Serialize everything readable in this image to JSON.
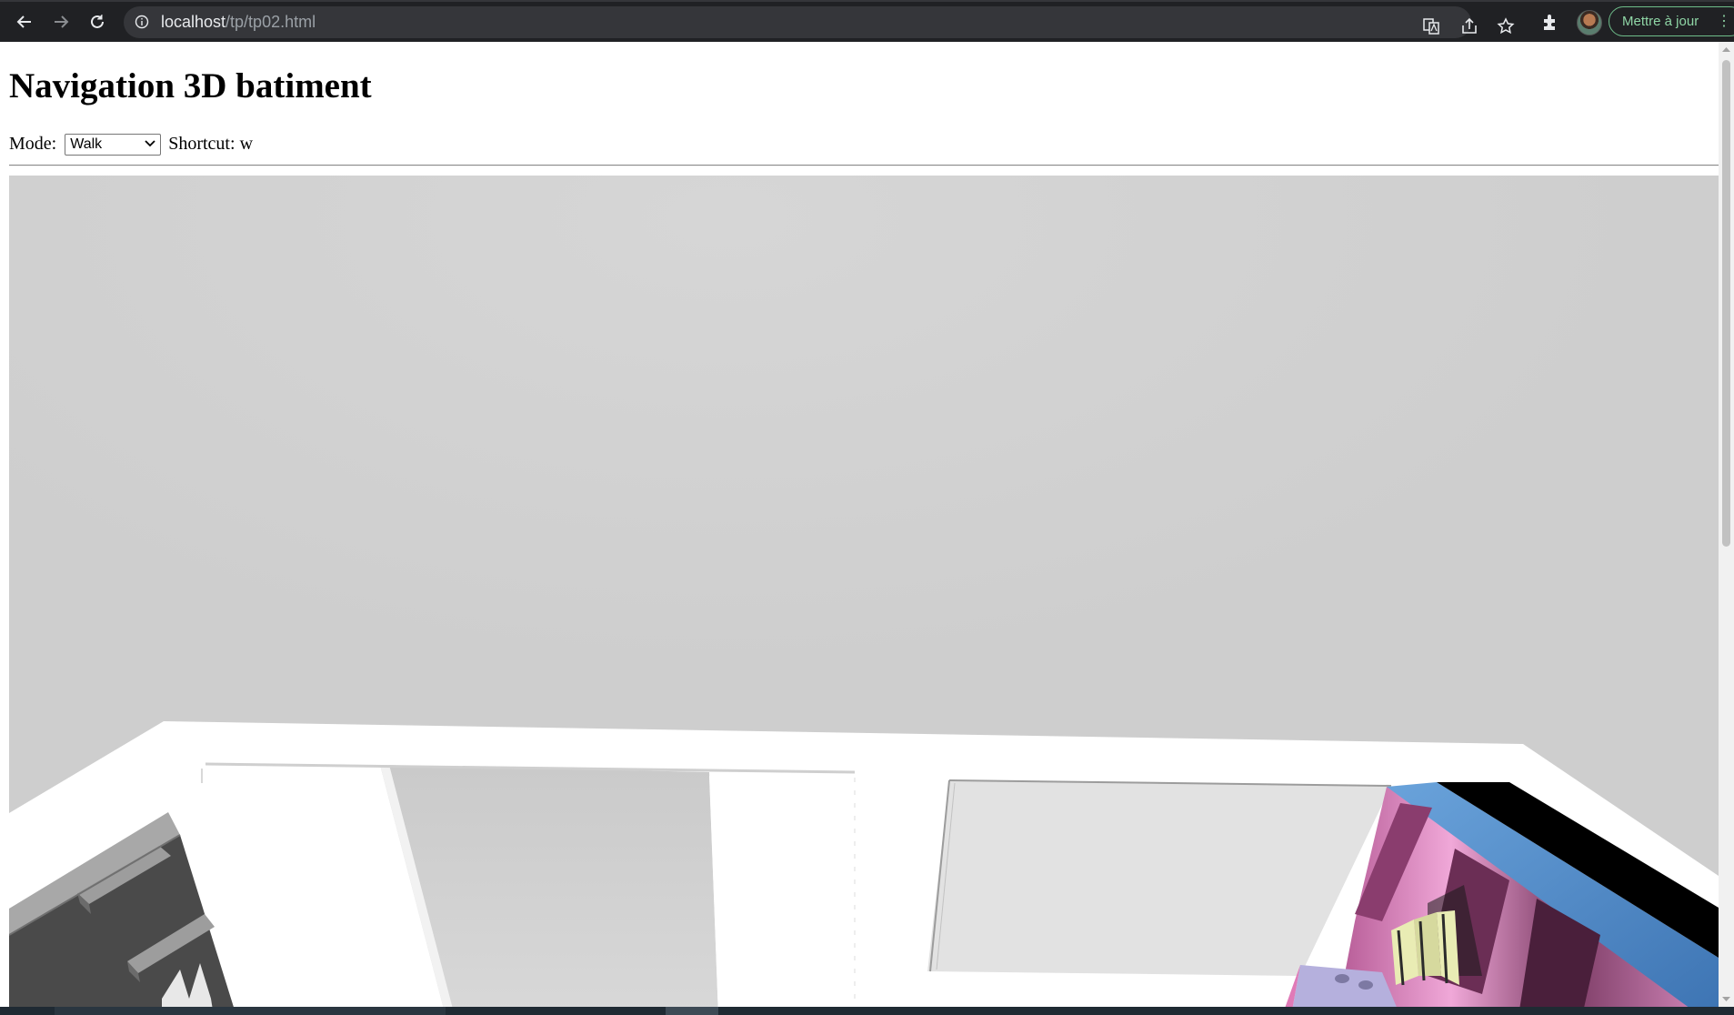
{
  "browser": {
    "url_host": "localhost",
    "url_path": "/tp/tp02.html",
    "update_button_label": "Mettre à jour",
    "icons": {
      "back": "arrow-left-icon",
      "forward": "arrow-right-icon",
      "reload": "reload-icon",
      "site_info": "info-icon",
      "translate": "translate-icon",
      "share": "share-icon",
      "bookmark": "star-icon",
      "extensions": "puzzle-icon",
      "profile": "avatar",
      "menu": "kebab-menu-icon"
    }
  },
  "page": {
    "title": "Navigation 3D batiment",
    "mode_label": "Mode:",
    "mode_selected": "Walk",
    "shortcut_label": "Shortcut:",
    "shortcut_key": "w"
  },
  "colors": {
    "chrome_bg": "#202124",
    "omnibox_bg": "#35363a",
    "update_accent": "#8fd6a6",
    "scene_background": "#cfcfcf",
    "furniture_pink": "#d67fb4",
    "furniture_blue": "#4a86c6"
  }
}
